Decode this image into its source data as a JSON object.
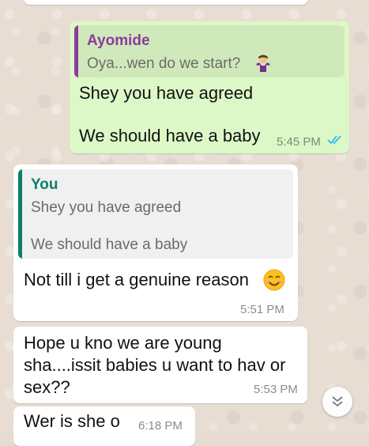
{
  "messages": [
    {
      "direction": "outgoing",
      "quote": {
        "author": "Ayomide",
        "text": "Oya...wen do we start?"
      },
      "lines": [
        "Shey you have agreed",
        "We should have a baby"
      ],
      "time": "5:45 PM",
      "status": "read"
    },
    {
      "direction": "incoming",
      "quote": {
        "author": "You",
        "lines": [
          "Shey you have agreed",
          "We should have a baby"
        ]
      },
      "lines": [
        "Not till i get a genuine reason"
      ],
      "time": "5:51 PM"
    },
    {
      "direction": "incoming",
      "lines": [
        "Hope u kno we are young",
        "sha....issit babies u want to hav or",
        "sex??"
      ],
      "time": "5:53 PM"
    },
    {
      "direction": "incoming",
      "lines": [
        "Wer is she o"
      ],
      "time": "6:18 PM"
    }
  ],
  "colors": {
    "outgoing_bubble": "#dcf8c6",
    "incoming_bubble": "#ffffff",
    "quote_ayomide_accent": "#8e3b9e",
    "quote_you_accent": "#0b7f6d",
    "read_ticks": "#34b7f1"
  },
  "icons": {
    "quote_emoji": "man-shrugging-emoji",
    "reply_emoji": "smiling-face-emoji",
    "status": "double-check-icon",
    "scroll": "double-chevron-down-icon"
  }
}
